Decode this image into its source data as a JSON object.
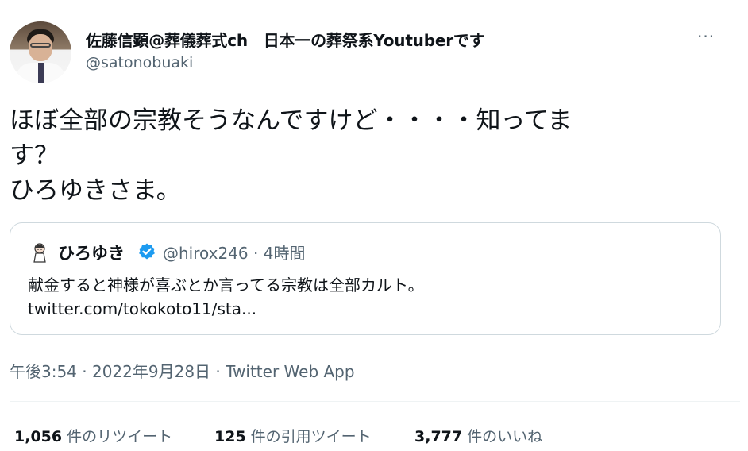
{
  "author": {
    "display_name": "佐藤信顕@葬儀葬式ch　日本一の葬祭系Youtuberです",
    "handle": "@satonobuaki"
  },
  "more_button": "···",
  "tweet": {
    "text": "ほぼ全部の宗教そうなんですけど・・・・知ってま\nす？\nひろゆきさま。",
    "timestamp": "午後3:54 · 2022年9月28日",
    "separator": " · ",
    "source": "Twitter Web App"
  },
  "quoted": {
    "display_name": "ひろゆき",
    "meta": "@hirox246 · 4時間",
    "text": "献金すると神様が喜ぶとか言ってる宗教は全部カルト。",
    "link": "twitter.com/tokokoto11/sta..."
  },
  "stats": {
    "retweets": {
      "count": "1,056",
      "label": "件のリツイート"
    },
    "quotes": {
      "count": "125",
      "label": "件の引用ツイート"
    },
    "likes": {
      "count": "3,777",
      "label": "件のいいね"
    }
  },
  "colors": {
    "text": "#0f1419",
    "secondary": "#536471",
    "border": "#cfd9de",
    "verified": "#1d9bf0"
  }
}
